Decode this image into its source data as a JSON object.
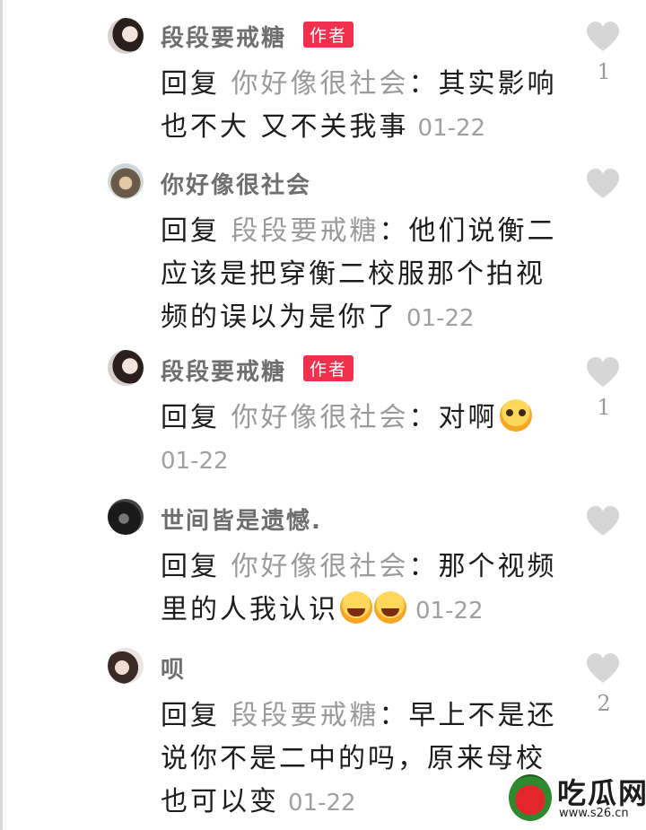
{
  "comments": [
    {
      "username": "段段要戒糖",
      "badge": "作者",
      "reply_word": "回复",
      "reply_to": "你好像很社会",
      "colon": "：",
      "text": "其实影响也不大 又不关我事",
      "date": "01-22",
      "likes": "1"
    },
    {
      "username": "你好像很社会",
      "reply_word": "回复",
      "reply_to": "段段要戒糖",
      "colon": "：",
      "text": "他们说衡二应该是把穿衡二校服那个拍视频的误以为是你了",
      "date": "01-22",
      "likes": ""
    },
    {
      "username": "段段要戒糖",
      "badge": "作者",
      "reply_word": "回复",
      "reply_to": "你好像很社会",
      "colon": "：",
      "text": "对啊",
      "emoji": "pleading-face",
      "date": "01-22",
      "likes": "1"
    },
    {
      "username": "世间皆是遗憾.",
      "reply_word": "回复",
      "reply_to": "你好像很社会",
      "colon": "：",
      "text": "那个视频里的人我认识",
      "emoji": "laughing-crying-face",
      "date": "01-22",
      "likes": ""
    },
    {
      "username": "呗",
      "reply_word": "回复",
      "reply_to": "段段要戒糖",
      "colon": "：",
      "text": "早上不是还说你不是二中的吗，原来母校也可以变",
      "date": "01-22",
      "likes": "2"
    }
  ],
  "watermark": {
    "brand": "吃瓜网",
    "url": "www.s26.cn"
  },
  "colors": {
    "badge": "#f0304c",
    "muted": "#9a9a9a",
    "heart": "#d6d6d6"
  }
}
